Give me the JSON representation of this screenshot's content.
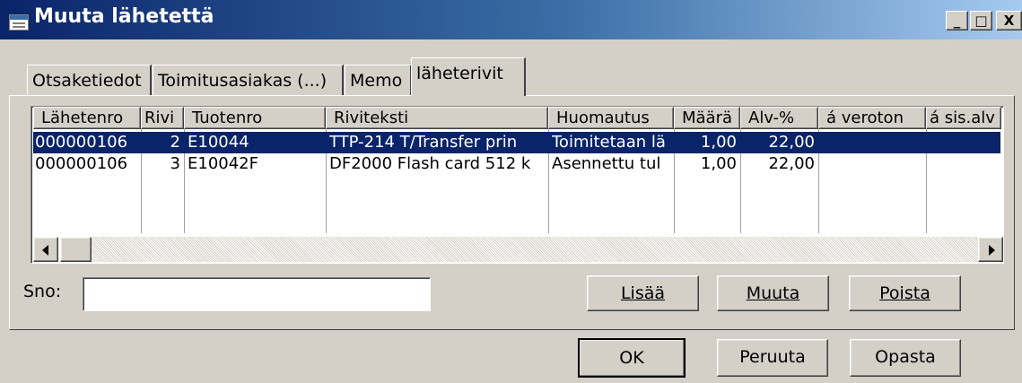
{
  "window": {
    "title": "Muuta lähetettä",
    "minimize_glyph": "_",
    "maximize_glyph": "□",
    "close_glyph": "X"
  },
  "tabs": [
    {
      "label": "Otsaketiedot"
    },
    {
      "label": "Toimitusasiakas (...)"
    },
    {
      "label": "Memo"
    },
    {
      "label": "läheterivit",
      "active": true
    }
  ],
  "grid": {
    "columns": [
      "Lähetenro",
      "Rivi",
      "Tuotenro",
      "Riviteksti",
      "Huomautus",
      "Määrä",
      "Alv-%",
      "á veroton",
      "á sis.alv"
    ],
    "rows": [
      {
        "lahetenro": "000000106",
        "rivi": "2",
        "tuotenro": "E10044",
        "riviteksti": "TTP-214 T/Transfer prin",
        "huomautus": "Toimitetaan lä",
        "maara": "1,00",
        "alv": "22,00",
        "veroton": "",
        "sisalv": "",
        "selected": true
      },
      {
        "lahetenro": "000000106",
        "rivi": "3",
        "tuotenro": "E10042F",
        "riviteksti": "DF2000 Flash card 512 k",
        "huomautus": "Asennettu tul",
        "maara": "1,00",
        "alv": "22,00",
        "veroton": "",
        "sisalv": "",
        "selected": false
      }
    ]
  },
  "sno": {
    "label": "Sno:",
    "value": ""
  },
  "buttons": {
    "lisaa": "Lisää",
    "muuta": "Muuta",
    "poista": "Poista",
    "ok": "OK",
    "peruuta": "Peruuta",
    "opasta": "Opasta"
  },
  "colors": {
    "titlebar_start": "#0a246a",
    "titlebar_end": "#a6caf0",
    "selection": "#0a246a",
    "face": "#d4d0c8"
  }
}
